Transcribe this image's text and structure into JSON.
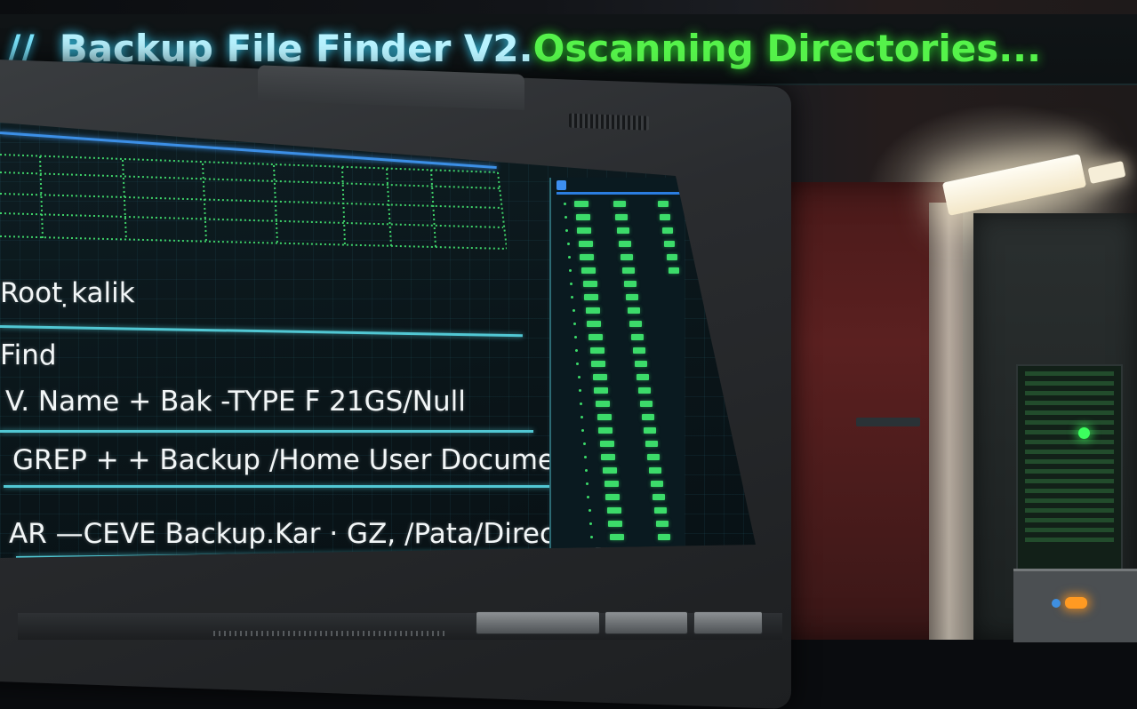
{
  "banner": {
    "slashes": "//",
    "title": "Backup File  Finder V2.",
    "status": "Oscanning Directories..."
  },
  "terminal": {
    "lines": [
      "Root ̣kalik",
      "Find",
      "V. Name  + Bak  -TYPE F  21GS/Null",
      "GREP + + Backup /Home User Documents",
      "AR —CEVE Backup.Kar · GZ, /Pata/Directory"
    ]
  },
  "colors": {
    "banner_title": "#b8f3ff",
    "banner_status": "#55f24a",
    "rule": "#51c7d3",
    "bars": "#3cdb6a"
  }
}
